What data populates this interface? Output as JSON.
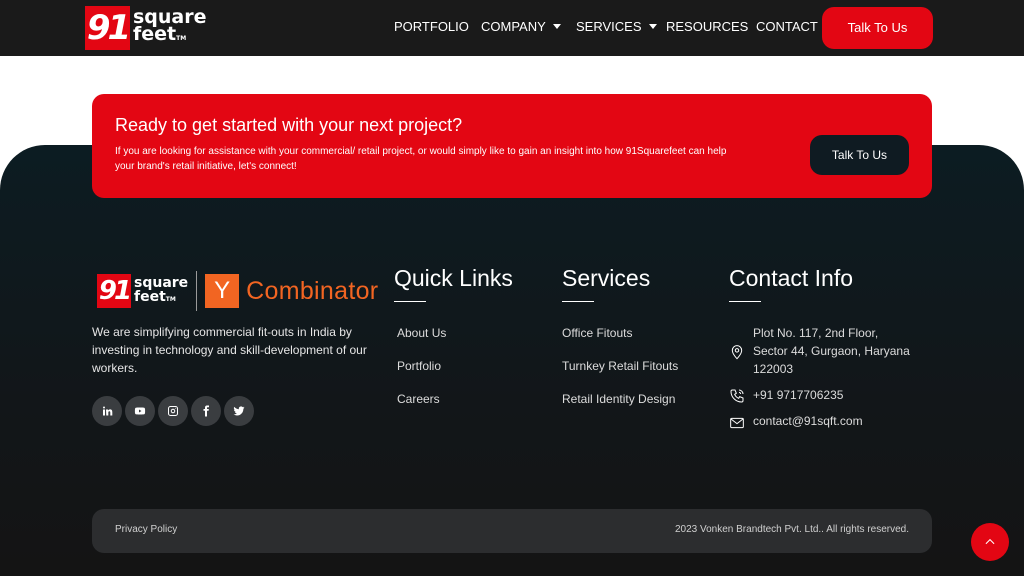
{
  "header": {
    "logo": {
      "mark": "91",
      "line1": "square",
      "line2": "feet",
      "tm": "TM"
    },
    "nav": [
      {
        "label": "PORTFOLIO",
        "dropdown": false
      },
      {
        "label": "COMPANY",
        "dropdown": true
      },
      {
        "label": "SERVICES",
        "dropdown": true
      },
      {
        "label": "RESOURCES",
        "dropdown": false
      },
      {
        "label": "CONTACT",
        "dropdown": false
      }
    ],
    "cta_label": "Talk To Us"
  },
  "cta": {
    "title": "Ready to get started with your next project?",
    "text": "If you are looking for assistance with your commercial/ retail project, or would simply like to gain an insight into how 91Squarefeet can help your brand's retail initiative, let's connect!",
    "button_label": "Talk To Us"
  },
  "footer": {
    "brand": {
      "yc_letter": "Y",
      "yc_text": "Combinator",
      "about": "We are simplifying commercial fit-outs in India by investing in technology and skill-development of our workers.",
      "socials": [
        "linkedin-icon",
        "youtube-icon",
        "instagram-icon",
        "facebook-icon",
        "twitter-icon"
      ]
    },
    "quick_links": {
      "title": "Quick Links",
      "items": [
        "About Us",
        "Portfolio",
        "Careers"
      ]
    },
    "services": {
      "title": "Services",
      "items": [
        "Office Fitouts",
        "Turnkey Retail Fitouts",
        "Retail Identity Design"
      ]
    },
    "contact": {
      "title": "Contact Info",
      "address": "Plot No. 117, 2nd Floor, Sector 44, Gurgaon, Haryana 122003",
      "phone": "+91 9717706235",
      "email": "contact@91sqft.com"
    }
  },
  "bottom": {
    "privacy": "Privacy Policy",
    "copyright": "2023 Vonken Brandtech Pvt. Ltd.. All rights reserved."
  },
  "colors": {
    "brand_red": "#e30613",
    "dark": "#1a1a1a",
    "yc_orange": "#f26522"
  }
}
